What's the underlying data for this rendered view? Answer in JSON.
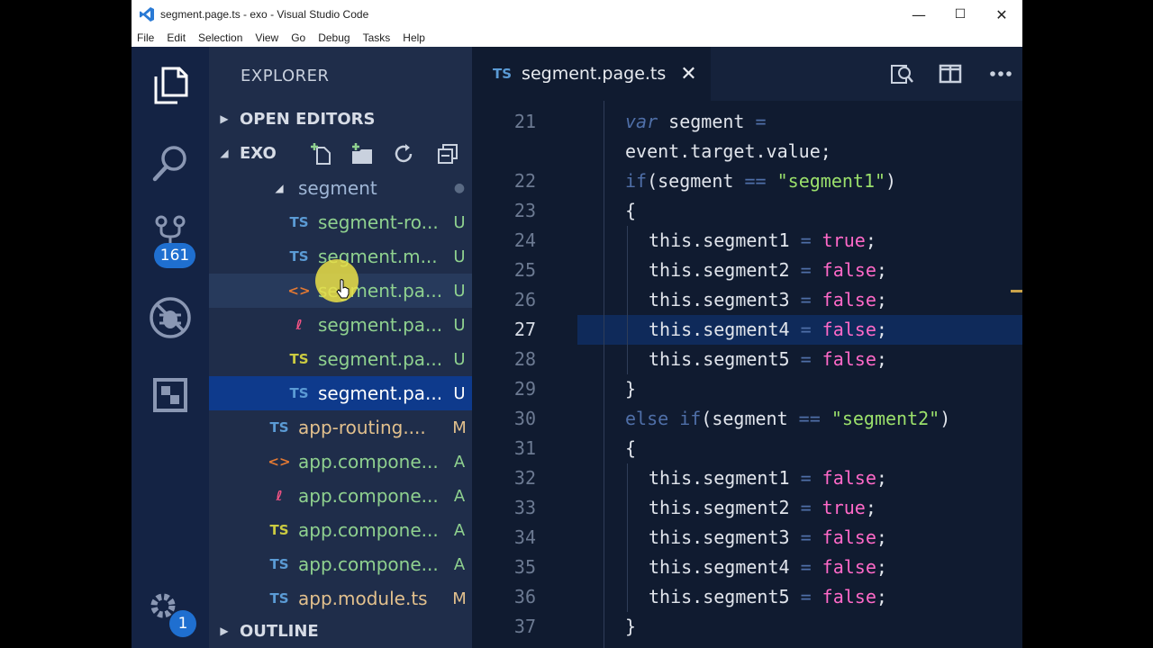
{
  "window": {
    "title": "segment.page.ts - exo - Visual Studio Code",
    "controls": {
      "minimize": "—",
      "maximize": "☐",
      "close": "✕"
    }
  },
  "menu": [
    "File",
    "Edit",
    "Selection",
    "View",
    "Go",
    "Debug",
    "Tasks",
    "Help"
  ],
  "activity_bar": {
    "items": [
      {
        "name": "explorer-icon"
      },
      {
        "name": "search-icon"
      },
      {
        "name": "source-control-icon",
        "badge": "161"
      },
      {
        "name": "debug-icon"
      },
      {
        "name": "extensions-icon"
      }
    ],
    "settings_badge": "1"
  },
  "sidebar": {
    "header": "EXPLORER",
    "open_editors": "OPEN EDITORS",
    "folder": "EXO",
    "outline": "OUTLINE",
    "tree": [
      {
        "icon": "",
        "icon_color": "#d7dce6",
        "name": "segment",
        "status": "●",
        "color": "#9fb6d6",
        "status_color": "#5a6a84",
        "indent": 1,
        "folder": true
      },
      {
        "icon": "TS",
        "icon_color": "#5b9bd5",
        "name": "segment-ro...",
        "status": "U",
        "color": "#8fd18f",
        "status_color": "#8fd18f",
        "indent": 2
      },
      {
        "icon": "TS",
        "icon_color": "#5b9bd5",
        "name": "segment.m...",
        "status": "U",
        "color": "#8fd18f",
        "status_color": "#8fd18f",
        "indent": 2
      },
      {
        "icon": "<>",
        "icon_color": "#e37933",
        "name": "segment.pa...",
        "status": "U",
        "color": "#8fd18f",
        "status_color": "#8fd18f",
        "indent": 2,
        "hover": true
      },
      {
        "icon": "ℓ",
        "icon_color": "#f55385",
        "name": "segment.pa...",
        "status": "U",
        "color": "#8fd18f",
        "status_color": "#8fd18f",
        "indent": 2
      },
      {
        "icon": "TS",
        "icon_color": "#cbcb41",
        "name": "segment.pa...",
        "status": "U",
        "color": "#8fd18f",
        "status_color": "#8fd18f",
        "indent": 2
      },
      {
        "icon": "TS",
        "icon_color": "#5b9bd5",
        "name": "segment.pa...",
        "status": "U",
        "color": "#ffffff",
        "status_color": "#ffffff",
        "indent": 2,
        "selected": true
      },
      {
        "icon": "TS",
        "icon_color": "#5b9bd5",
        "name": "app-routing....",
        "status": "M",
        "color": "#e2c08d",
        "status_color": "#e2c08d",
        "indent": 1
      },
      {
        "icon": "<>",
        "icon_color": "#e37933",
        "name": "app.compone...",
        "status": "A",
        "color": "#8fd18f",
        "status_color": "#8fd18f",
        "indent": 1
      },
      {
        "icon": "ℓ",
        "icon_color": "#f55385",
        "name": "app.compone...",
        "status": "A",
        "color": "#8fd18f",
        "status_color": "#8fd18f",
        "indent": 1
      },
      {
        "icon": "TS",
        "icon_color": "#cbcb41",
        "name": "app.compone...",
        "status": "A",
        "color": "#8fd18f",
        "status_color": "#8fd18f",
        "indent": 1
      },
      {
        "icon": "TS",
        "icon_color": "#5b9bd5",
        "name": "app.compone...",
        "status": "A",
        "color": "#8fd18f",
        "status_color": "#8fd18f",
        "indent": 1
      },
      {
        "icon": "TS",
        "icon_color": "#5b9bd5",
        "name": "app.module.ts",
        "status": "M",
        "color": "#e2c08d",
        "status_color": "#e2c08d",
        "indent": 1
      }
    ]
  },
  "editor": {
    "tab": {
      "lang": "TS",
      "name": "segment.page.ts",
      "close": "✕"
    },
    "lines": [
      {
        "n": "21",
        "indent": 0,
        "parts": [
          [
            "kw",
            "var"
          ],
          [
            "t",
            " segment "
          ],
          [
            "op",
            "="
          ]
        ]
      },
      {
        "n": "",
        "indent": 0,
        "parts": [
          [
            "t",
            "event.target.value;"
          ]
        ]
      },
      {
        "n": "22",
        "indent": 0,
        "parts": [
          [
            "kw",
            "if"
          ],
          [
            "t",
            "(segment "
          ],
          [
            "op",
            "=="
          ],
          [
            "t",
            " "
          ],
          [
            "str",
            "\"segment1\""
          ],
          [
            "t",
            ")"
          ]
        ]
      },
      {
        "n": "23",
        "indent": 0,
        "parts": [
          [
            "t",
            "{"
          ]
        ]
      },
      {
        "n": "24",
        "indent": 1,
        "parts": [
          [
            "t",
            "this.segment1 "
          ],
          [
            "op",
            "="
          ],
          [
            "t",
            " "
          ],
          [
            "bool",
            "true"
          ],
          [
            "t",
            ";"
          ]
        ]
      },
      {
        "n": "25",
        "indent": 1,
        "parts": [
          [
            "t",
            "this.segment2 "
          ],
          [
            "op",
            "="
          ],
          [
            "t",
            " "
          ],
          [
            "bool",
            "false"
          ],
          [
            "t",
            ";"
          ]
        ]
      },
      {
        "n": "26",
        "indent": 1,
        "parts": [
          [
            "t",
            "this.segment3 "
          ],
          [
            "op",
            "="
          ],
          [
            "t",
            " "
          ],
          [
            "bool",
            "false"
          ],
          [
            "t",
            ";"
          ]
        ]
      },
      {
        "n": "27",
        "indent": 1,
        "parts": [
          [
            "t",
            "this.segment4 "
          ],
          [
            "op",
            "="
          ],
          [
            "t",
            " "
          ],
          [
            "bool",
            "false"
          ],
          [
            "t",
            ";"
          ]
        ],
        "current": true
      },
      {
        "n": "28",
        "indent": 1,
        "parts": [
          [
            "t",
            "this.segment5 "
          ],
          [
            "op",
            "="
          ],
          [
            "t",
            " "
          ],
          [
            "bool",
            "false"
          ],
          [
            "t",
            ";"
          ]
        ]
      },
      {
        "n": "29",
        "indent": 0,
        "parts": [
          [
            "t",
            "}"
          ]
        ]
      },
      {
        "n": "30",
        "indent": 0,
        "parts": [
          [
            "kw",
            "else if"
          ],
          [
            "t",
            "(segment "
          ],
          [
            "op",
            "=="
          ],
          [
            "t",
            " "
          ],
          [
            "str",
            "\"segment2\""
          ],
          [
            "t",
            ")"
          ]
        ]
      },
      {
        "n": "31",
        "indent": 0,
        "parts": [
          [
            "t",
            "{"
          ]
        ]
      },
      {
        "n": "32",
        "indent": 1,
        "parts": [
          [
            "t",
            "this.segment1 "
          ],
          [
            "op",
            "="
          ],
          [
            "t",
            " "
          ],
          [
            "bool",
            "false"
          ],
          [
            "t",
            ";"
          ]
        ]
      },
      {
        "n": "33",
        "indent": 1,
        "parts": [
          [
            "t",
            "this.segment2 "
          ],
          [
            "op",
            "="
          ],
          [
            "t",
            " "
          ],
          [
            "bool",
            "true"
          ],
          [
            "t",
            ";"
          ]
        ]
      },
      {
        "n": "34",
        "indent": 1,
        "parts": [
          [
            "t",
            "this.segment3 "
          ],
          [
            "op",
            "="
          ],
          [
            "t",
            " "
          ],
          [
            "bool",
            "false"
          ],
          [
            "t",
            ";"
          ]
        ]
      },
      {
        "n": "35",
        "indent": 1,
        "parts": [
          [
            "t",
            "this.segment4 "
          ],
          [
            "op",
            "="
          ],
          [
            "t",
            " "
          ],
          [
            "bool",
            "false"
          ],
          [
            "t",
            ";"
          ]
        ]
      },
      {
        "n": "36",
        "indent": 1,
        "parts": [
          [
            "t",
            "this.segment5 "
          ],
          [
            "op",
            "="
          ],
          [
            "t",
            " "
          ],
          [
            "bool",
            "false"
          ],
          [
            "t",
            ";"
          ]
        ]
      },
      {
        "n": "37",
        "indent": 0,
        "parts": [
          [
            "t",
            "}"
          ]
        ]
      }
    ]
  }
}
